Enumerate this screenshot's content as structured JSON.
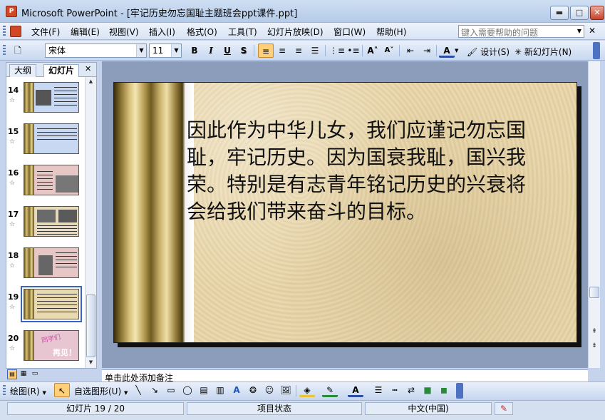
{
  "window": {
    "title": "Microsoft PowerPoint - [牢记历史勿忘国耻主题班会ppt课件.ppt]",
    "app_icon": "P"
  },
  "menu": {
    "items": [
      "文件(F)",
      "编辑(E)",
      "视图(V)",
      "插入(I)",
      "格式(O)",
      "工具(T)",
      "幻灯片放映(D)",
      "窗口(W)",
      "帮助(H)"
    ],
    "help_placeholder": "键入需要帮助的问题"
  },
  "toolbar": {
    "font": "宋体",
    "size": "11",
    "bold": "B",
    "italic": "I",
    "underline": "U",
    "shadow": "S",
    "design_label": "设计(S)",
    "new_slide_label": "新幻灯片(N)"
  },
  "panel": {
    "tabs": [
      "大纲",
      "幻灯片"
    ],
    "slides": [
      {
        "num": "14",
        "bg": "#c9d8f2"
      },
      {
        "num": "15",
        "bg": "#c9d8f2"
      },
      {
        "num": "16",
        "bg": "#e7c6c6"
      },
      {
        "num": "17",
        "bg": "#e8d9b8"
      },
      {
        "num": "18",
        "bg": "#e7c6c6"
      },
      {
        "num": "19",
        "bg": "#e8d9b0"
      },
      {
        "num": "20",
        "bg": "#e7c6d2",
        "text": "同学们",
        "text2": "再见！"
      }
    ]
  },
  "slide": {
    "text": "因此作为中华儿女，我们应谨记勿忘国耻，牢记历史。因为国衰我耻，国兴我荣。特别是有志青年铭记历史的兴衰将会给我们带来奋斗的目标。"
  },
  "notes": {
    "placeholder": "单击此处添加备注"
  },
  "drawbar": {
    "draw_label": "绘图(R)",
    "autoshape_label": "自选图形(U)"
  },
  "status": {
    "slide_info": "幻灯片 19 / 20",
    "design": "项目状态",
    "language": "中文(中国)"
  }
}
